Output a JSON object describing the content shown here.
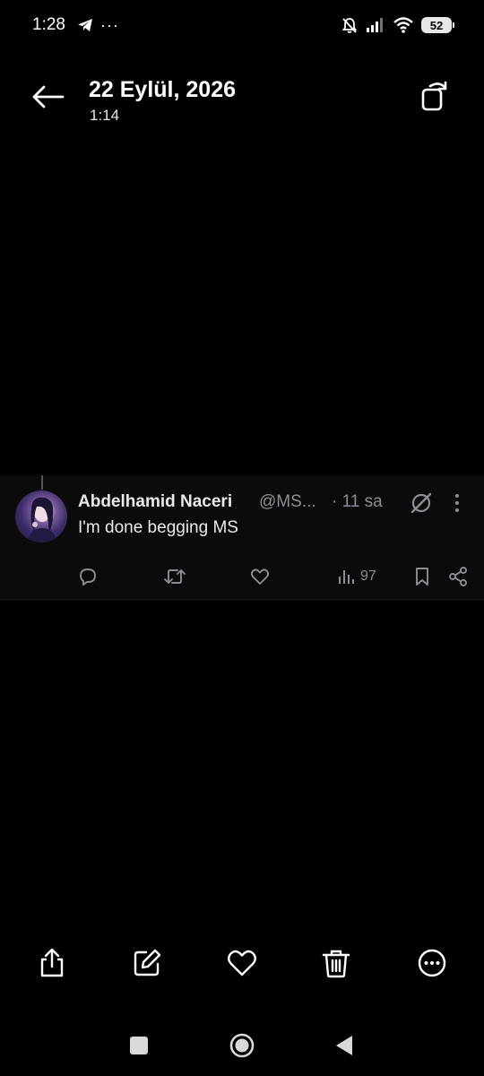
{
  "status_bar": {
    "time": "1:28",
    "dots": "···",
    "battery": "52"
  },
  "header": {
    "date": "22 Eylül, 2026",
    "time": "1:14"
  },
  "tweet": {
    "author_name": "Abdelhamid Naceri",
    "handle": "@MS...",
    "time_ago": "· 11 sa",
    "text": "I'm done begging MS",
    "views": "97"
  },
  "colors": {
    "background": "#000000",
    "card": "#0b0b0c",
    "muted_text": "#8b8f95",
    "text": "#e9e9e9"
  },
  "icons": {
    "status_bar": [
      "telegram-icon",
      "more-dots",
      "muted-bell-icon",
      "signal-icon",
      "wifi-icon",
      "battery-icon"
    ],
    "header": [
      "back-arrow-icon",
      "rotate-screen-icon"
    ],
    "tweet": [
      "grok-icon",
      "more-vertical-icon",
      "reply-icon",
      "retweet-icon",
      "like-icon",
      "views-icon",
      "bookmark-icon",
      "share-icon"
    ],
    "toolbar": [
      "share-icon",
      "edit-icon",
      "heart-icon",
      "trash-icon",
      "more-circle-icon"
    ],
    "navigation": [
      "recents-square",
      "home-circle",
      "back-triangle"
    ]
  }
}
